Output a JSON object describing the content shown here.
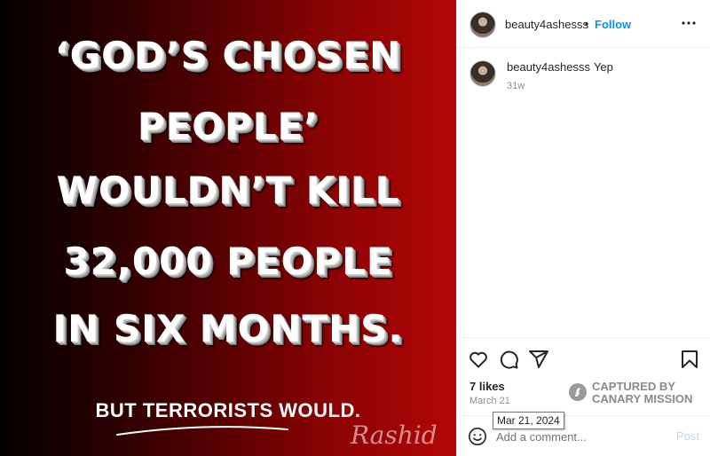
{
  "post_image": {
    "headline_lines": [
      "‘GOD’S CHOSEN",
      "PEOPLE’",
      "WOULDN’T KILL",
      "32,000 PEOPLE",
      "IN SIX MONTHS."
    ],
    "tagline": "BUT TERRORISTS WOULD.",
    "signature": "Rashid"
  },
  "header": {
    "username": "beauty4ashesss",
    "separator": "•",
    "follow_label": "Follow",
    "more_icon": "more-horizontal-icon"
  },
  "comment": {
    "username": "beauty4ashesss",
    "text": "Yep",
    "age": "31w"
  },
  "actions": {
    "icons": [
      "heart-icon",
      "comment-icon",
      "share-icon",
      "bookmark-icon"
    ]
  },
  "likes": "7 likes",
  "post_date": "March 21",
  "tooltip": "Mar 21, 2024",
  "watermark": {
    "line1": "CAPTURED BY",
    "line2": "CANARY MISSION"
  },
  "add_comment": {
    "placeholder": "Add a comment...",
    "post_label": "Post"
  }
}
